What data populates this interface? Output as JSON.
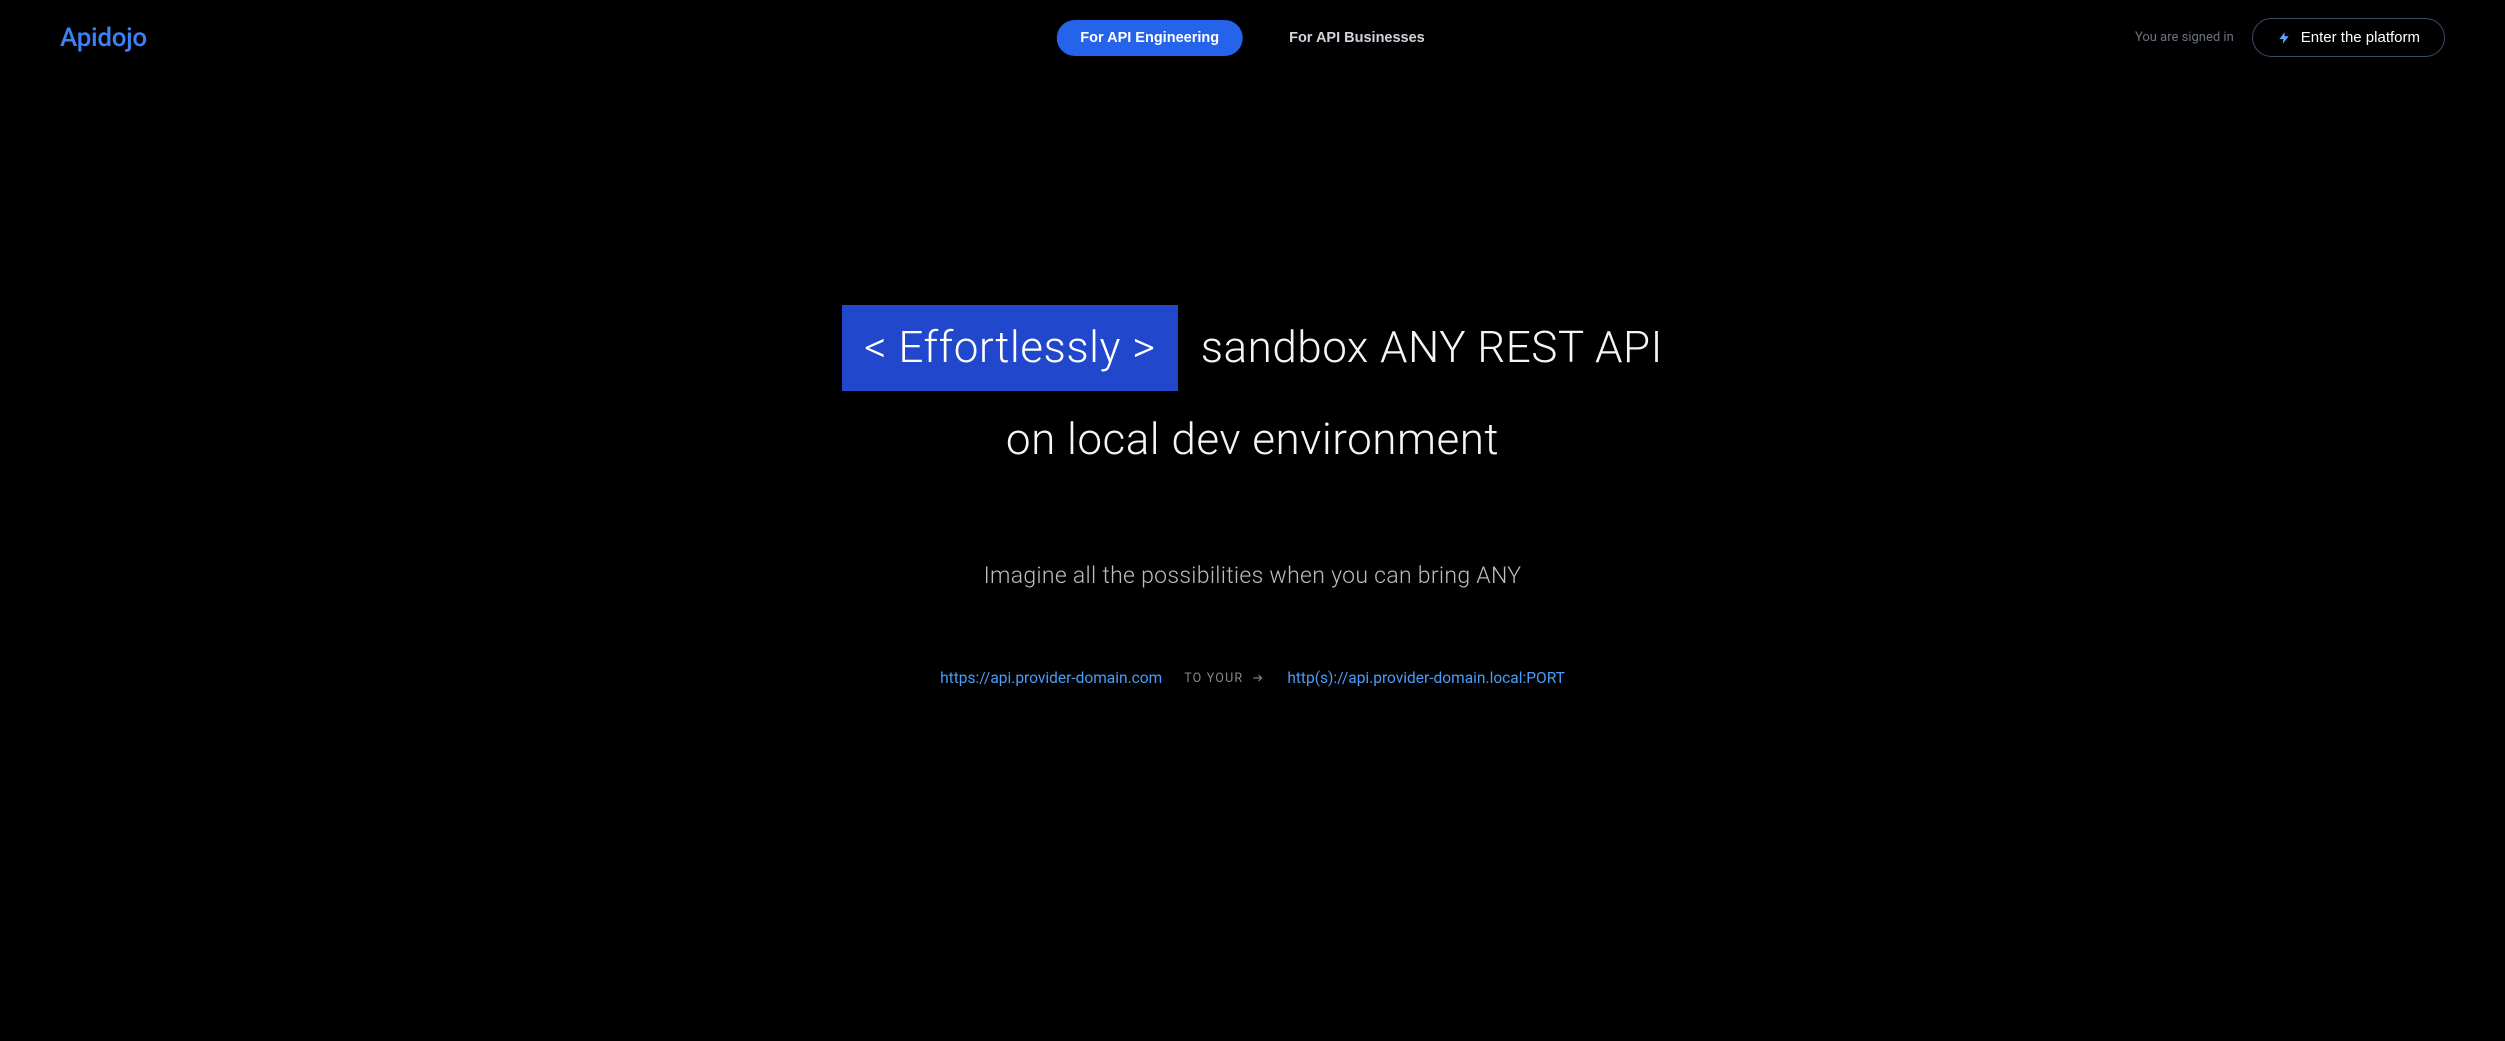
{
  "header": {
    "logo": "Apidojo",
    "nav": {
      "engineering": "For API Engineering",
      "businesses": "For API Businesses"
    },
    "signed_in": "You are signed in",
    "enter": "Enter the platform"
  },
  "hero": {
    "highlight": "< Effortlessly >",
    "line1_rest": "sandbox ANY REST API",
    "line2": "on local dev environment",
    "sub": "Imagine all the possibilities when you can bring ANY",
    "url_from": "https://api.provider-domain.com",
    "to_your": "TO YOUR",
    "url_to": "http(s)://api.provider-domain.local:PORT"
  },
  "colors": {
    "accent": "#2563eb",
    "logo": "#3b82f6",
    "highlight_bg": "#2047cc",
    "link": "#4b9cf7"
  }
}
